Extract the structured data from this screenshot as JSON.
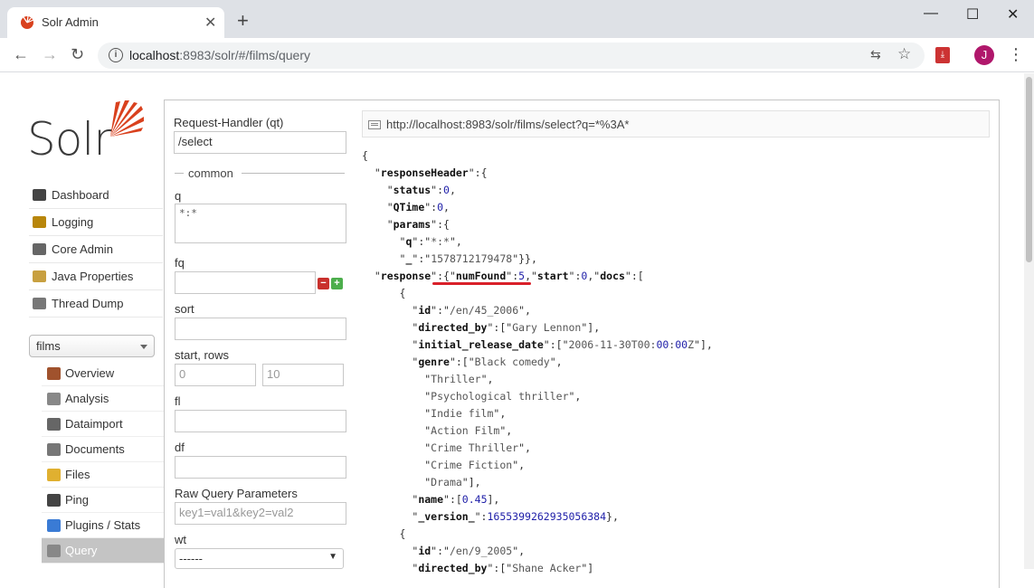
{
  "browser": {
    "tab_title": "Solr Admin",
    "url_host": "localhost",
    "url_rest": ":8983/solr/#/films/query",
    "avatar_letter": "J"
  },
  "logo_text": "Solr",
  "nav": [
    {
      "label": "Dashboard",
      "icon": "dashboard-icon"
    },
    {
      "label": "Logging",
      "icon": "logging-icon"
    },
    {
      "label": "Core Admin",
      "icon": "core-admin-icon"
    },
    {
      "label": "Java Properties",
      "icon": "java-properties-icon"
    },
    {
      "label": "Thread Dump",
      "icon": "thread-dump-icon"
    }
  ],
  "core_selector": "films",
  "core_nav": [
    {
      "label": "Overview",
      "icon": "overview-icon"
    },
    {
      "label": "Analysis",
      "icon": "analysis-icon"
    },
    {
      "label": "Dataimport",
      "icon": "dataimport-icon"
    },
    {
      "label": "Documents",
      "icon": "documents-icon"
    },
    {
      "label": "Files",
      "icon": "files-icon"
    },
    {
      "label": "Ping",
      "icon": "ping-icon"
    },
    {
      "label": "Plugins / Stats",
      "icon": "plugins-icon"
    },
    {
      "label": "Query",
      "icon": "query-icon",
      "active": true
    }
  ],
  "form": {
    "request_handler_label": "Request-Handler (qt)",
    "request_handler_value": "/select",
    "common_label": "common",
    "q_label": "q",
    "q_value": "*:*",
    "fq_label": "fq",
    "fq_value": "",
    "sort_label": "sort",
    "sort_value": "",
    "start_rows_label": "start, rows",
    "start_placeholder": "0",
    "rows_placeholder": "10",
    "fl_label": "fl",
    "df_label": "df",
    "raw_label": "Raw Query Parameters",
    "raw_placeholder": "key1=val1&key2=val2",
    "wt_label": "wt",
    "wt_value": "------"
  },
  "result_url": "http://localhost:8983/solr/films/select?q=*%3A*",
  "json_lines": [
    "{",
    "  \"responseHeader\":{",
    "    \"status\":0,",
    "    \"QTime\":0,",
    "    \"params\":{",
    "      \"q\":\"*:*\",",
    "      \"_\":\"1578712179478\"}},",
    "  \"response\":{\"numFound\":5,\"start\":0,\"docs\":[",
    "      {",
    "        \"id\":\"/en/45_2006\",",
    "        \"directed_by\":[\"Gary Lennon\"],",
    "        \"initial_release_date\":[\"2006-11-30T00:00:00Z\"],",
    "        \"genre\":[\"Black comedy\",",
    "          \"Thriller\",",
    "          \"Psychological thriller\",",
    "          \"Indie film\",",
    "          \"Action Film\",",
    "          \"Crime Thriller\",",
    "          \"Crime Fiction\",",
    "          \"Drama\"],",
    "        \"name\":[0.45],",
    "        \"_version_\":1655399262935056384},",
    "      {",
    "        \"id\":\"/en/9_2005\",",
    "        \"directed_by\":[\"Shane Acker\"]"
  ]
}
